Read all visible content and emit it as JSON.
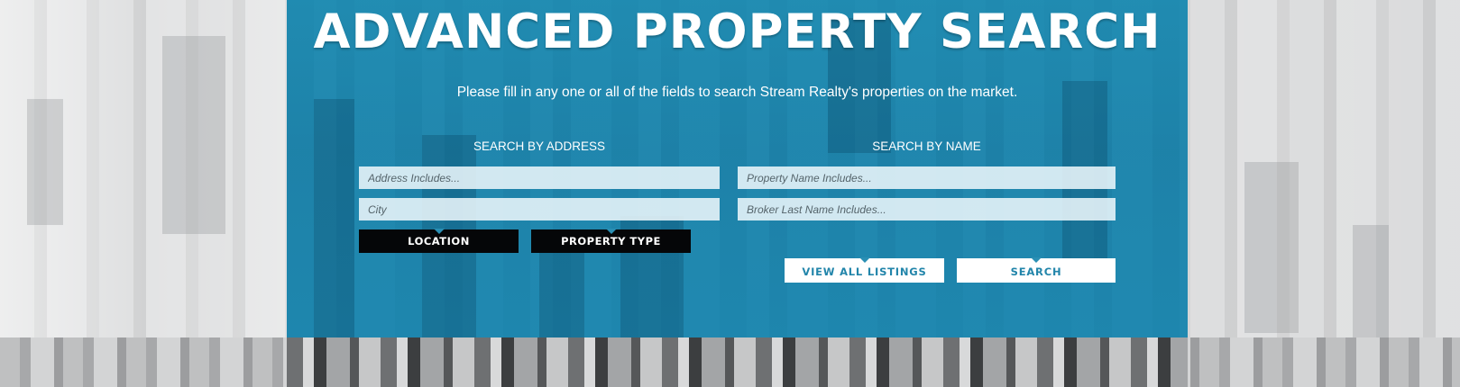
{
  "page": {
    "title": "ADVANCED PROPERTY SEARCH",
    "subtitle": "Please fill in any one or all of the fields to search Stream Realty's properties on the market."
  },
  "address_section": {
    "heading": "SEARCH BY ADDRESS",
    "address_placeholder": "Address Includes...",
    "city_placeholder": "City",
    "location_label": "LOCATION",
    "property_type_label": "PROPERTY TYPE"
  },
  "name_section": {
    "heading": "SEARCH BY NAME",
    "property_name_placeholder": "Property Name Includes...",
    "broker_placeholder": "Broker Last Name Includes..."
  },
  "actions": {
    "view_all_label": "VIEW ALL LISTINGS",
    "search_label": "SEARCH"
  },
  "colors": {
    "panel": "#2a94b8",
    "button_text": "#2285aa",
    "dark_button": "#050608"
  }
}
